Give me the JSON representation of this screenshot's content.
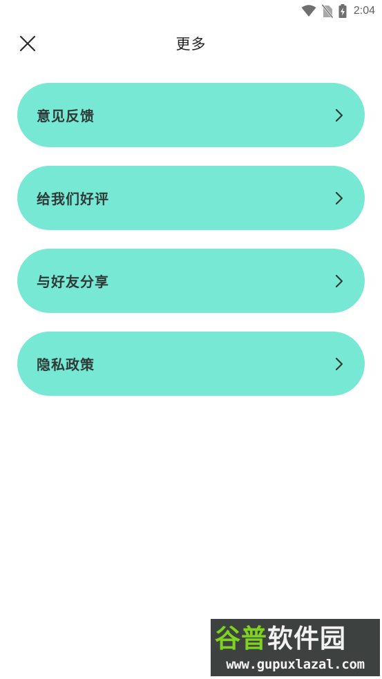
{
  "status_bar": {
    "time": "2:04",
    "icons": [
      "wifi-icon",
      "no-sim-icon",
      "battery-charging-icon"
    ]
  },
  "header": {
    "title": "更多",
    "close_icon": "close-icon"
  },
  "menu": {
    "items": [
      {
        "label": "意见反馈",
        "icon": "chevron-right-icon"
      },
      {
        "label": "给我们好评",
        "icon": "chevron-right-icon"
      },
      {
        "label": "与好友分享",
        "icon": "chevron-right-icon"
      },
      {
        "label": "隐私政策",
        "icon": "chevron-right-icon"
      }
    ]
  },
  "watermark": {
    "brand_part1": "谷普",
    "brand_part2": "软件园",
    "url": "www.gupuxlazal.com"
  },
  "colors": {
    "item_background": "#76e8d3",
    "label_text": "#2f3a38",
    "title_text": "#222222"
  }
}
